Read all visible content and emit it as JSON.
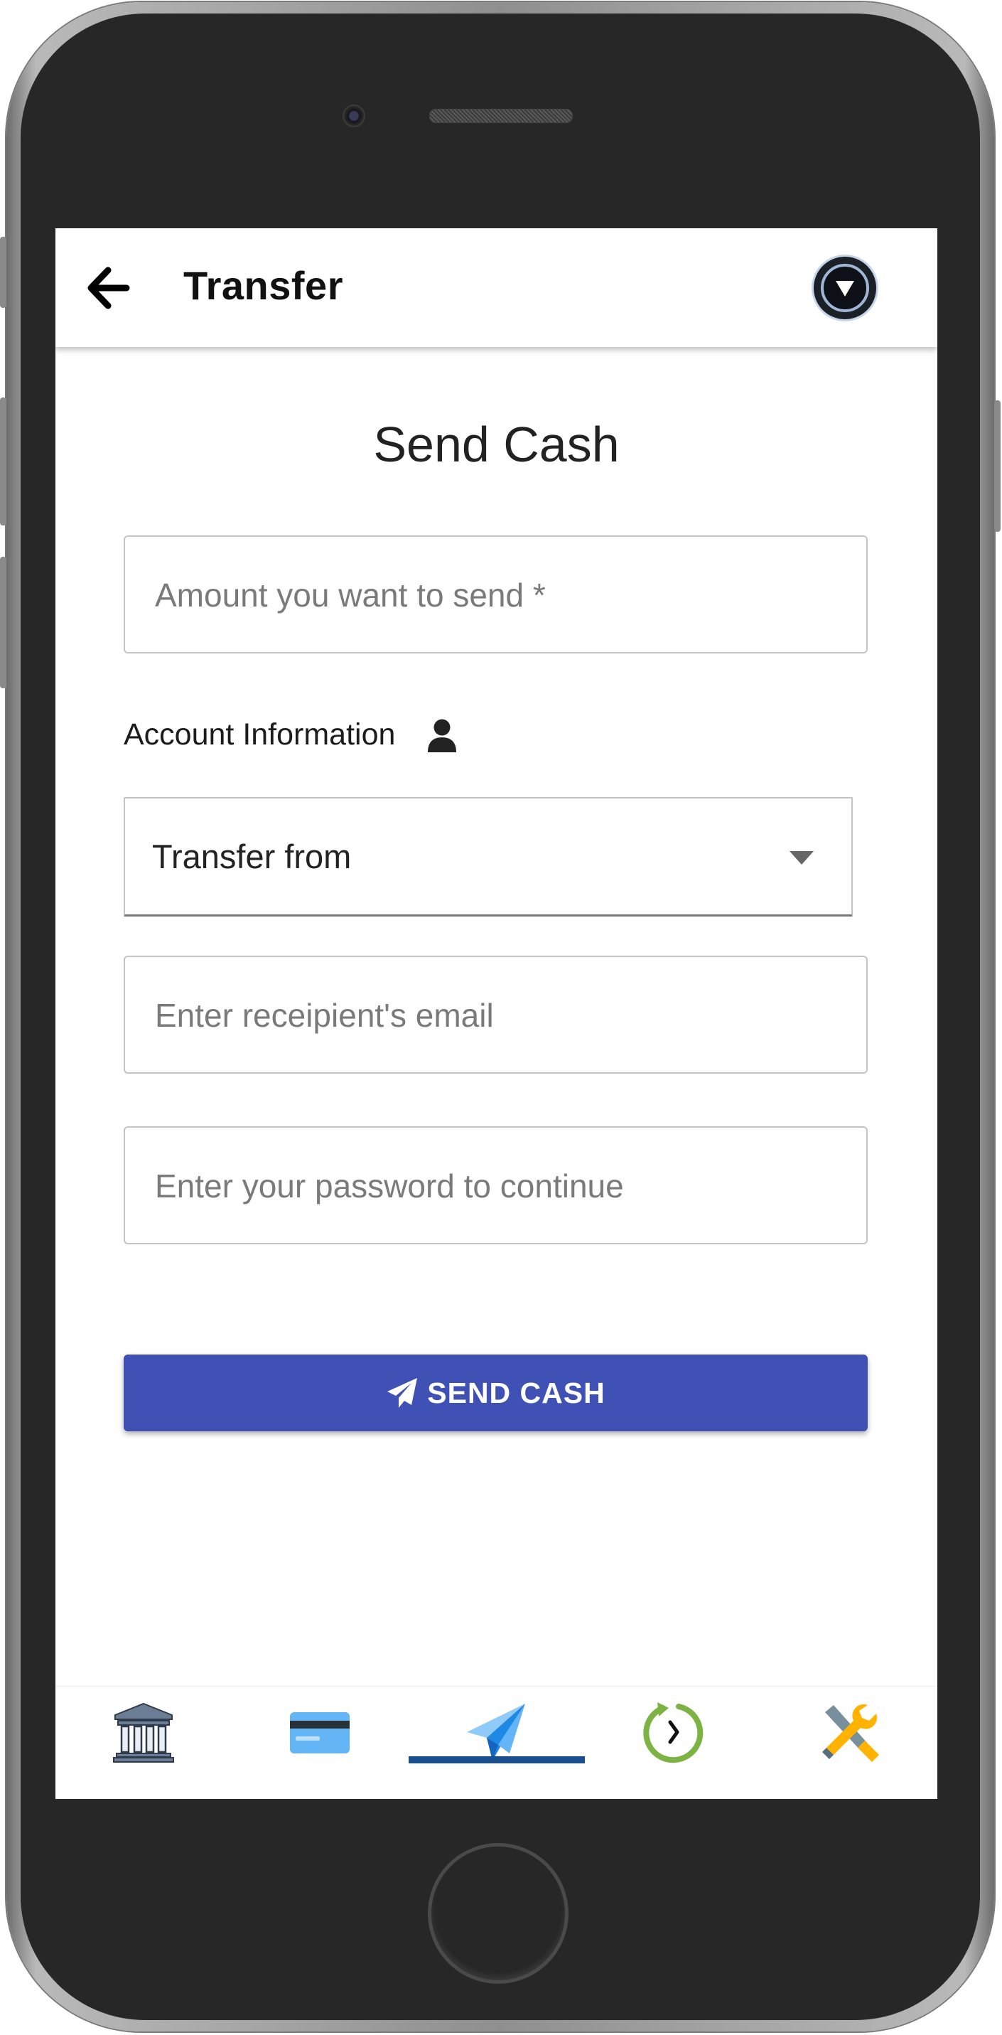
{
  "app_bar": {
    "title": "Transfer",
    "back_icon": "arrow-left-icon",
    "profile_icon": "profile-menu-icon"
  },
  "form": {
    "heading": "Send Cash",
    "amount_placeholder": "Amount you want to send *",
    "account_section_label": "Account Information",
    "account_section_icon": "person-icon",
    "transfer_from_value": "Transfer from",
    "recipient_email_placeholder": "Enter receipient's email",
    "password_placeholder": "Enter your password to continue",
    "submit_label": "SEND CASH",
    "submit_icon": "paper-plane-icon"
  },
  "bottom_nav": {
    "items": [
      {
        "icon": "bank-icon",
        "active": false
      },
      {
        "icon": "credit-card-icon",
        "active": false
      },
      {
        "icon": "paper-plane-icon",
        "active": true
      },
      {
        "icon": "history-clock-icon",
        "active": false
      },
      {
        "icon": "tools-icon",
        "active": false
      }
    ]
  },
  "colors": {
    "primary_button": "#3f51b5",
    "active_tab_indicator": "#1a4f8f",
    "phone_body": "#272727"
  }
}
